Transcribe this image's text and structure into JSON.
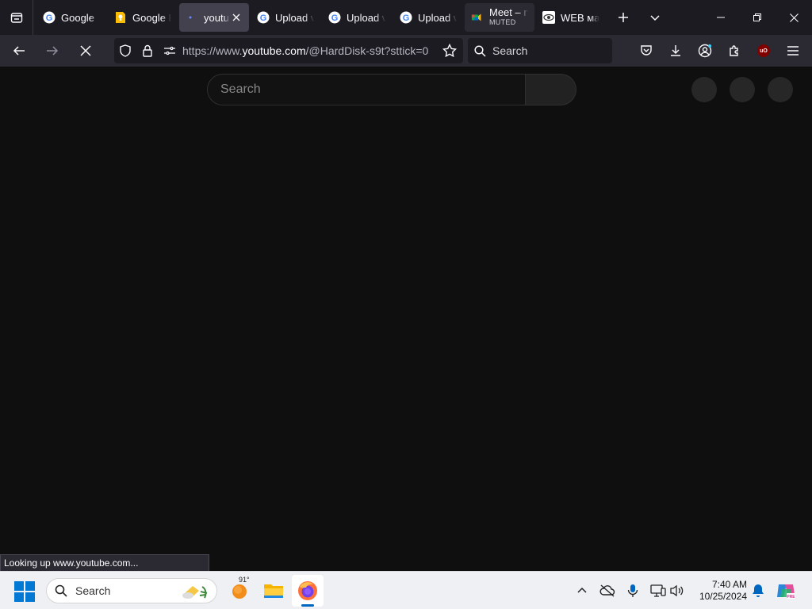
{
  "browser": {
    "tabs": [
      {
        "title": "Google",
        "favicon": "google-g-icon",
        "state": "normal"
      },
      {
        "title": "Google K",
        "favicon": "google-keep-icon",
        "state": "normal"
      },
      {
        "title": "youtu",
        "favicon": "loading-dot-icon",
        "state": "active"
      },
      {
        "title": "Upload v",
        "favicon": "google-g-icon",
        "state": "normal"
      },
      {
        "title": "Upload v",
        "favicon": "google-g-icon",
        "state": "normal"
      },
      {
        "title": "Upload v",
        "favicon": "google-g-icon",
        "state": "normal"
      },
      {
        "title": "Meet – n",
        "subtitle": "MUTED",
        "favicon": "google-meet-icon",
        "state": "hovered"
      },
      {
        "title": "WEB мас",
        "favicon": "eye-icon",
        "state": "normal"
      }
    ],
    "url": {
      "prefix": "https://www.",
      "host": "youtube.com",
      "path": "/@HardDisk-s9t?sttick=0"
    },
    "search_placeholder": "Search",
    "status_text": "Looking up www.youtube.com..."
  },
  "page": {
    "search_placeholder": "Search"
  },
  "taskbar": {
    "search_placeholder": "Search",
    "weather_temp": "91°",
    "time": "7:40 AM",
    "date": "10/25/2024"
  },
  "colors": {
    "browser_chrome": "#1c1b22",
    "toolbar": "#2b2a33",
    "page_bg": "#0f0f0f",
    "taskbar_bg": "#eef0f3",
    "accent": "#0067c0"
  }
}
